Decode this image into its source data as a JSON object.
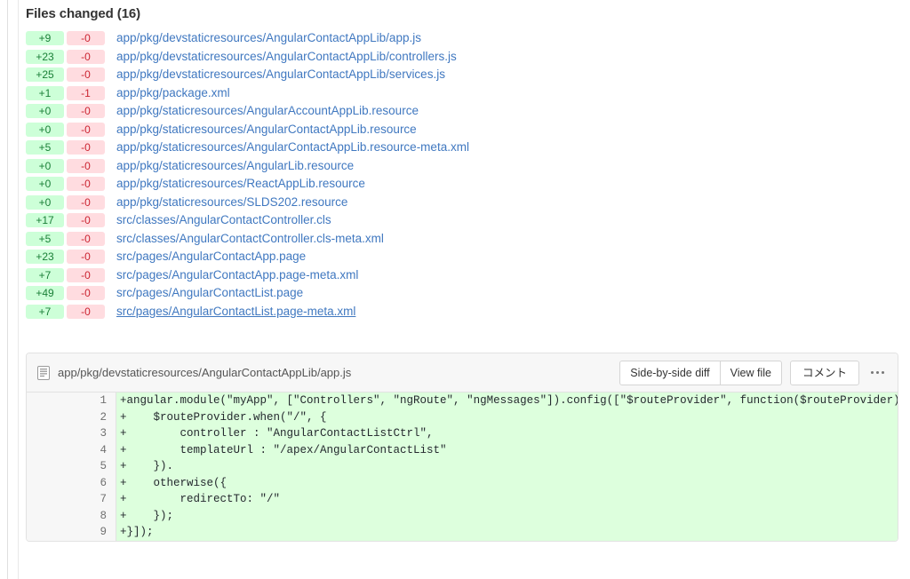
{
  "page": {
    "heading": "Files changed (16)"
  },
  "files": [
    {
      "additions": "+9",
      "deletions": "-0",
      "path": "app/pkg/devstaticresources/AngularContactAppLib/app.js",
      "hovered": false
    },
    {
      "additions": "+23",
      "deletions": "-0",
      "path": "app/pkg/devstaticresources/AngularContactAppLib/controllers.js",
      "hovered": false
    },
    {
      "additions": "+25",
      "deletions": "-0",
      "path": "app/pkg/devstaticresources/AngularContactAppLib/services.js",
      "hovered": false
    },
    {
      "additions": "+1",
      "deletions": "-1",
      "path": "app/pkg/package.xml",
      "hovered": false
    },
    {
      "additions": "+0",
      "deletions": "-0",
      "path": "app/pkg/staticresources/AngularAccountAppLib.resource",
      "hovered": false
    },
    {
      "additions": "+0",
      "deletions": "-0",
      "path": "app/pkg/staticresources/AngularContactAppLib.resource",
      "hovered": false
    },
    {
      "additions": "+5",
      "deletions": "-0",
      "path": "app/pkg/staticresources/AngularContactAppLib.resource-meta.xml",
      "hovered": false
    },
    {
      "additions": "+0",
      "deletions": "-0",
      "path": "app/pkg/staticresources/AngularLib.resource",
      "hovered": false
    },
    {
      "additions": "+0",
      "deletions": "-0",
      "path": "app/pkg/staticresources/ReactAppLib.resource",
      "hovered": false
    },
    {
      "additions": "+0",
      "deletions": "-0",
      "path": "app/pkg/staticresources/SLDS202.resource",
      "hovered": false
    },
    {
      "additions": "+17",
      "deletions": "-0",
      "path": "src/classes/AngularContactController.cls",
      "hovered": false
    },
    {
      "additions": "+5",
      "deletions": "-0",
      "path": "src/classes/AngularContactController.cls-meta.xml",
      "hovered": false
    },
    {
      "additions": "+23",
      "deletions": "-0",
      "path": "src/pages/AngularContactApp.page",
      "hovered": false
    },
    {
      "additions": "+7",
      "deletions": "-0",
      "path": "src/pages/AngularContactApp.page-meta.xml",
      "hovered": false
    },
    {
      "additions": "+49",
      "deletions": "-0",
      "path": "src/pages/AngularContactList.page",
      "hovered": false
    },
    {
      "additions": "+7",
      "deletions": "-0",
      "path": "src/pages/AngularContactList.page-meta.xml",
      "hovered": true
    }
  ],
  "diff": {
    "file_path": "app/pkg/devstaticresources/AngularContactAppLib/app.js",
    "file_icon": "file-text-icon",
    "actions": {
      "side_by_side_label": "Side-by-side diff",
      "view_file_label": "View file",
      "comment_label": "コメント",
      "kebab_label": "..."
    },
    "lines": [
      {
        "number": "1",
        "text": "+angular.module(\"myApp\", [\"Controllers\", \"ngRoute\", \"ngMessages\"]).config([\"$routeProvider\", function($routeProvider){"
      },
      {
        "number": "2",
        "text": "+    $routeProvider.when(\"/\", {"
      },
      {
        "number": "3",
        "text": "+        controller : \"AngularContactListCtrl\","
      },
      {
        "number": "4",
        "text": "+        templateUrl : \"/apex/AngularContactList\""
      },
      {
        "number": "5",
        "text": "+    })."
      },
      {
        "number": "6",
        "text": "+    otherwise({"
      },
      {
        "number": "7",
        "text": "+        redirectTo: \"/\""
      },
      {
        "number": "8",
        "text": "+    });"
      },
      {
        "number": "9",
        "text": "+}]);"
      }
    ]
  },
  "colors": {
    "link": "#4078c0",
    "addition_bg": "#cdffd8",
    "addition_text": "#1a7f37",
    "deletion_bg": "#ffdce0",
    "deletion_text": "#cb2431",
    "diff_line_bg": "#ddffdd",
    "panel_header_bg": "#f7f7f7",
    "border": "#e2e2e2"
  }
}
